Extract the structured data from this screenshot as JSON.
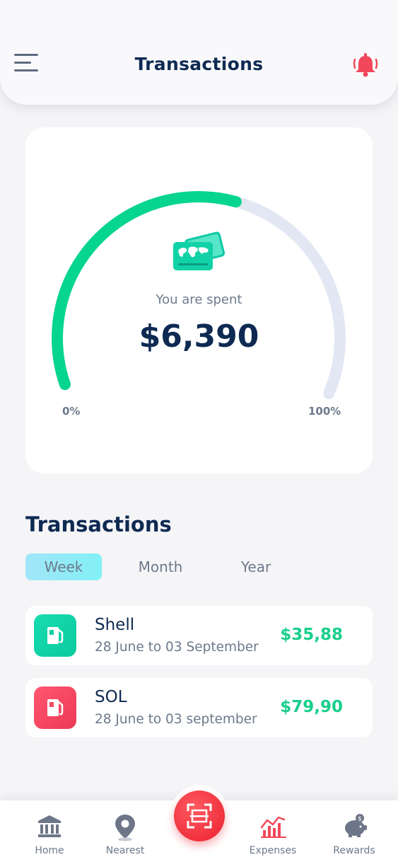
{
  "header": {
    "title": "Transactions",
    "menu_icon": "hamburger-menu-icon",
    "notification_icon": "bell-icon"
  },
  "gauge": {
    "label": "You are spent",
    "amount": "$6,390",
    "min_label": "0%",
    "max_label": "100%",
    "progress": 0.56,
    "icon": "credit-cards-icon",
    "fill_color": "#05d58e",
    "track_color": "#e2e7f3"
  },
  "transactions": {
    "title": "Transactions",
    "tabs": [
      {
        "label": "Week",
        "active": true
      },
      {
        "label": "Month",
        "active": false
      },
      {
        "label": "Year",
        "active": false
      }
    ],
    "items": [
      {
        "name": "Shell",
        "dates": "28 June to 03 September",
        "amount": "$35,88",
        "icon": "fuel-pump-icon",
        "icon_color": "#14d6a6"
      },
      {
        "name": "SOL",
        "dates": "28 June to 03 september",
        "amount": "$79,90",
        "icon": "fuel-pump-icon",
        "icon_color": "#f04a62"
      }
    ]
  },
  "bottom_nav": {
    "items": [
      {
        "label": "Home",
        "icon": "bank-icon"
      },
      {
        "label": "Nearest",
        "icon": "location-pin-icon"
      },
      {
        "label": "Expenses",
        "icon": "chart-icon"
      },
      {
        "label": "Rewards",
        "icon": "piggy-bank-icon"
      }
    ],
    "scan_icon": "scan-icon"
  },
  "colors": {
    "accent_green": "#19cf8c",
    "accent_red": "#ea1f2d",
    "text_dark": "#0e2a52",
    "text_muted": "#6d7a8c"
  }
}
